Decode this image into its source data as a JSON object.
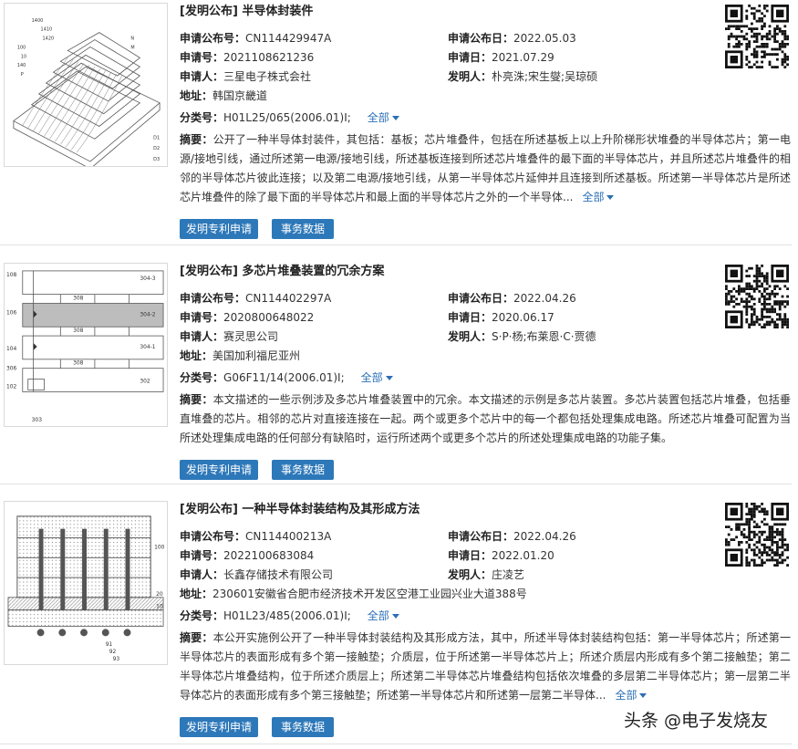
{
  "records": [
    {
      "tag": "[发明公布]",
      "title": "半导体封装件",
      "pub_no_label": "申请公布号：",
      "pub_no": "CN114429947A",
      "pub_date_label": "申请公布日：",
      "pub_date": "2022.05.03",
      "app_no_label": "申请号：",
      "app_no": "2021108621236",
      "app_date_label": "申请日：",
      "app_date": "2021.07.29",
      "applicant_label": "申请人：",
      "applicant": "三星电子株式会社",
      "inventor_label": "发明人：",
      "inventor": "朴亮洙;宋生燮;吴琼硕",
      "address_label": "地址：",
      "address": "韩国京畿道",
      "class_label": "分类号：",
      "class": "H01L25/065(2006.01)I;",
      "more_label": "全部",
      "abstract_label": "摘要：",
      "abstract": "公开了一种半导体封装件，其包括：基板；芯片堆叠件，包括在所述基板上以上升阶梯形状堆叠的半导体芯片；第一电源/接地引线，通过所述第一电源/接地引线，所述基板连接到所述芯片堆叠件的最下面的半导体芯片，并且所述芯片堆叠件的相邻的半导体芯片彼此连接；以及第二电源/接地引线，从第一半导体芯片延伸并且连接到所述基板。所述第一半导体芯片是所述芯片堆叠件的除了最下面的半导体芯片和最上面的半导体芯片之外的一个半导体...",
      "abstract_more": "全部",
      "btn_patent": "发明专利申请",
      "btn_events": "事务数据"
    },
    {
      "tag": "[发明公布]",
      "title": "多芯片堆叠装置的冗余方案",
      "pub_no_label": "申请公布号：",
      "pub_no": "CN114402297A",
      "pub_date_label": "申请公布日：",
      "pub_date": "2022.04.26",
      "app_no_label": "申请号：",
      "app_no": "2020800648022",
      "app_date_label": "申请日：",
      "app_date": "2020.06.17",
      "applicant_label": "申请人：",
      "applicant": "赛灵思公司",
      "inventor_label": "发明人：",
      "inventor": "S·P·杨;布莱恩·C·贾德",
      "address_label": "地址：",
      "address": "美国加利福尼亚州",
      "class_label": "分类号：",
      "class": "G06F11/14(2006.01)I;",
      "more_label": "全部",
      "abstract_label": "摘要：",
      "abstract": "本文描述的一些示例涉及多芯片堆叠装置中的冗余。本文描述的示例是多芯片装置。多芯片装置包括芯片堆叠，包括垂直堆叠的芯片。相邻的芯片对直接连接在一起。两个或更多个芯片中的每一个都包括处理集成电路。所述芯片堆叠可配置为当所述处理集成电路的任何部分有缺陷时，运行所述两个或更多个芯片的所述处理集成电路的功能子集。",
      "abstract_more": "",
      "btn_patent": "发明专利申请",
      "btn_events": "事务数据",
      "figure_labels": [
        "108",
        "106",
        "104",
        "102",
        "306",
        "303",
        "304-3",
        "304-2",
        "304-1",
        "302",
        "308",
        "308",
        "308"
      ]
    },
    {
      "tag": "[发明公布]",
      "title": "一种半导体封装结构及其形成方法",
      "pub_no_label": "申请公布号：",
      "pub_no": "CN114400213A",
      "pub_date_label": "申请公布日：",
      "pub_date": "2022.04.26",
      "app_no_label": "申请号：",
      "app_no": "2022100683084",
      "app_date_label": "申请日：",
      "app_date": "2022.01.20",
      "applicant_label": "申请人：",
      "applicant": "长鑫存储技术有限公司",
      "inventor_label": "发明人：",
      "inventor": "庄凌艺",
      "address_label": "地址：",
      "address": "230601安徽省合肥市经济技术开发区空港工业园兴业大道388号",
      "class_label": "分类号：",
      "class": "H01L23/485(2006.01)I;",
      "more_label": "全部",
      "abstract_label": "摘要：",
      "abstract": "本公开实施例公开了一种半导体封装结构及其形成方法，其中，所述半导体封装结构包括：第一半导体芯片；所述第一半导体芯片的表面形成有多个第一接触垫；介质层，位于所述第一半导体芯片上；所述介质层内形成有多个第二接触垫；第二半导体芯片堆叠结构，位于所述介质层上；所述第二半导体芯片堆叠结构包括依次堆叠的多层第二半导体芯片；第一层第二半导体芯片的表面形成有多个第三接触垫；所述第一半导体芯片和所述第一层第二半导体...",
      "abstract_more": "全部",
      "btn_patent": "发明专利申请",
      "btn_events": "事务数据",
      "figure_labels": [
        "100",
        "20",
        "10",
        "91",
        "92",
        "93"
      ]
    }
  ],
  "watermark": "头条 @电子发烧友",
  "colors": {
    "button": "#2d78b9",
    "link": "#2b6fb6",
    "divider": "#e2e2e2"
  },
  "icons": [
    "qr-code-icon",
    "chevron-down-icon"
  ]
}
